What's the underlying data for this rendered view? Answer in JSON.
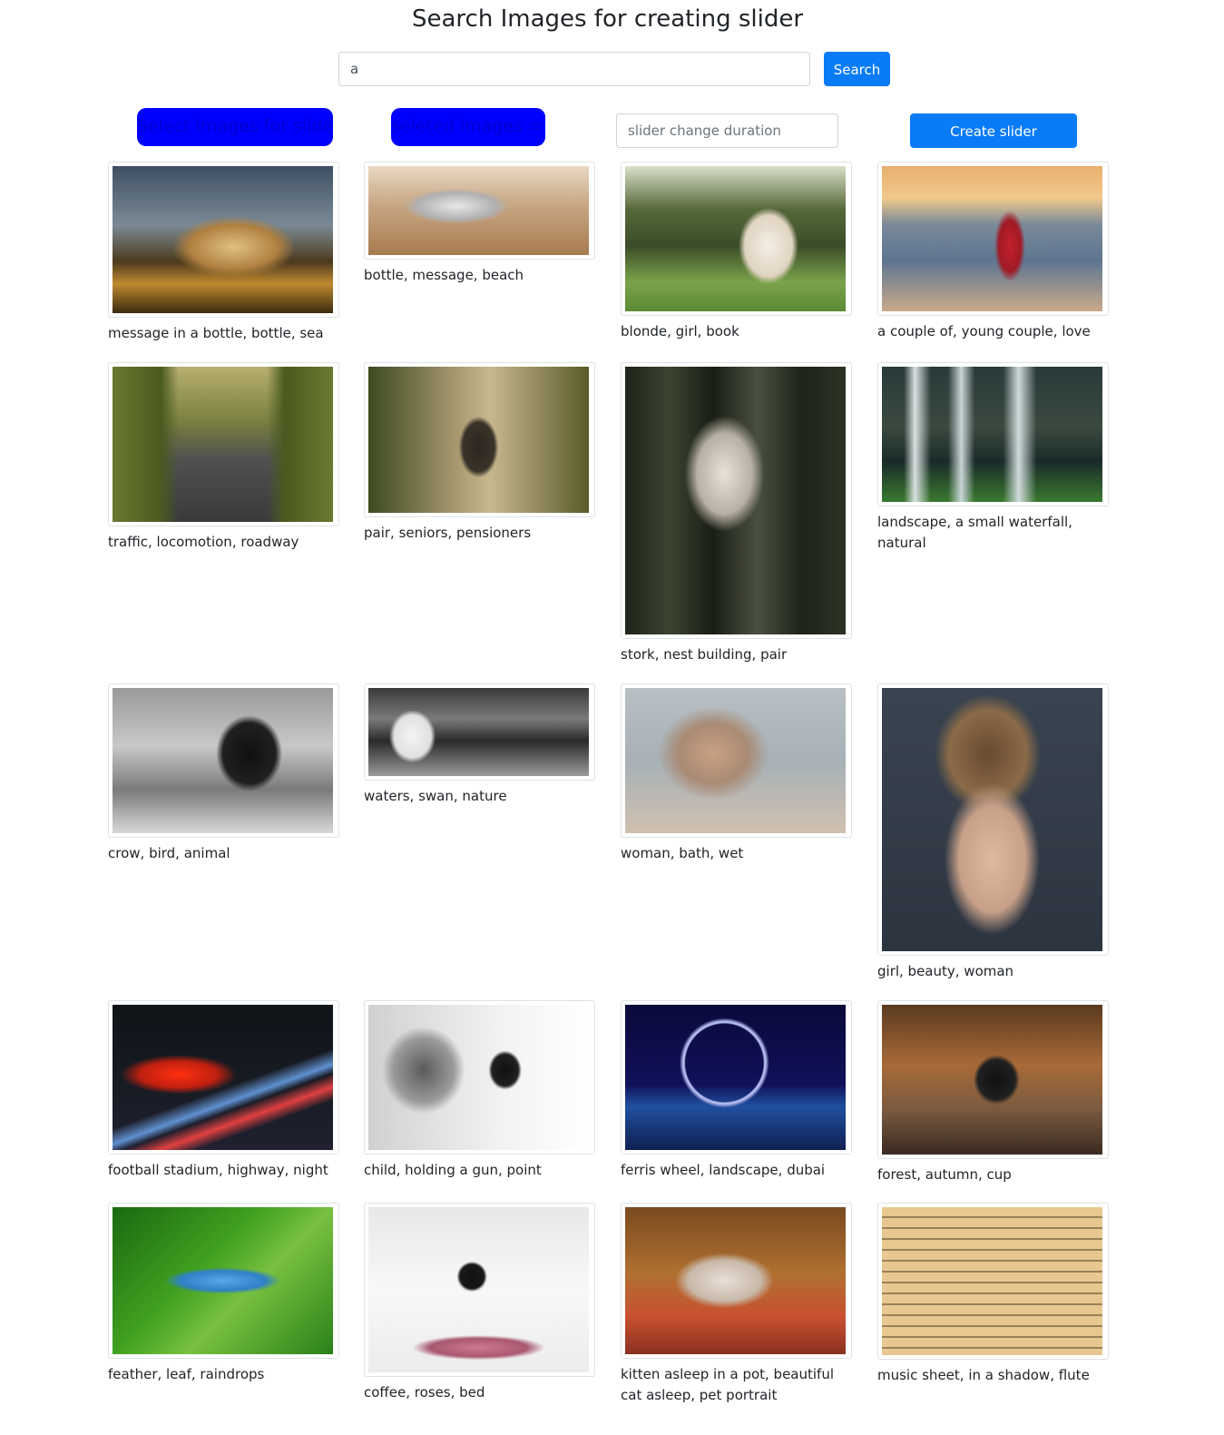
{
  "header": {
    "title": "Search Images for creating slider"
  },
  "search": {
    "value": "a",
    "button_label": "Search"
  },
  "toolbar": {
    "select_label": "Select images for slider",
    "selected_label": "seleted images = ",
    "selected_count": "0",
    "duration_placeholder": "slider change duration",
    "create_label": "Create slider"
  },
  "images": [
    {
      "caption": "message in a bottle, bottle, sea"
    },
    {
      "caption": "bottle, message, beach"
    },
    {
      "caption": "blonde, girl, book"
    },
    {
      "caption": "a couple of, young couple, love"
    },
    {
      "caption": "traffic, locomotion, roadway"
    },
    {
      "caption": "pair, seniors, pensioners"
    },
    {
      "caption": "stork, nest building, pair"
    },
    {
      "caption": "landscape, a small waterfall, natural"
    },
    {
      "caption": "crow, bird, animal"
    },
    {
      "caption": "waters, swan, nature"
    },
    {
      "caption": "woman, bath, wet"
    },
    {
      "caption": "girl, beauty, woman"
    },
    {
      "caption": "football stadium, highway, night"
    },
    {
      "caption": "child, holding a gun, point"
    },
    {
      "caption": "ferris wheel, landscape, dubai"
    },
    {
      "caption": "forest, autumn, cup"
    },
    {
      "caption": "feather, leaf, raindrops"
    },
    {
      "caption": "coffee, roses, bed"
    },
    {
      "caption": "kitten asleep in a pot, beautiful cat asleep, pet portrait"
    },
    {
      "caption": "music sheet, in a shadow, flute"
    }
  ]
}
